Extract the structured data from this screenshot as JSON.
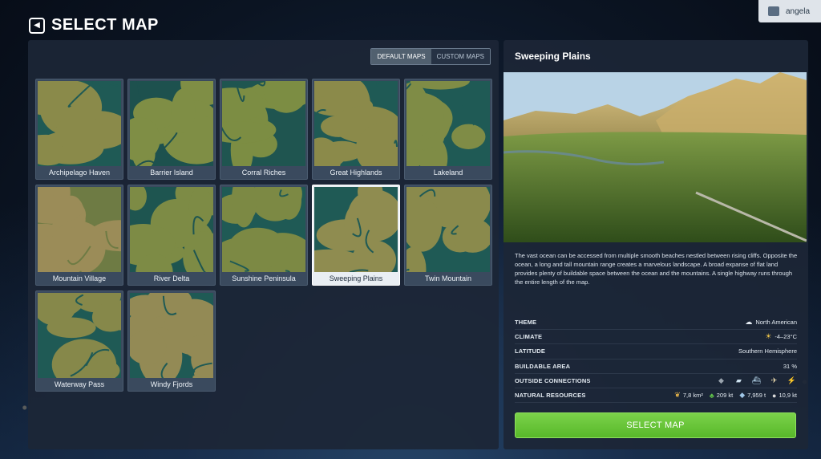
{
  "header": {
    "title": "SELECT MAP",
    "back_icon": "◀"
  },
  "user": {
    "name": "angela"
  },
  "tabs": [
    {
      "label": "DEFAULT MAPS",
      "active": true
    },
    {
      "label": "CUSTOM MAPS",
      "active": false
    }
  ],
  "maps": [
    {
      "name": "Archipelago Haven",
      "land": "#8a8a4a",
      "water": "#1f5a55"
    },
    {
      "name": "Barrier Island",
      "land": "#7f8e45",
      "water": "#1d514e"
    },
    {
      "name": "Corral Riches",
      "land": "#7c8d43",
      "water": "#1f5550"
    },
    {
      "name": "Great Highlands",
      "land": "#8b8a4a",
      "water": "#1f5a55"
    },
    {
      "name": "Lakeland",
      "land": "#7f8c46",
      "water": "#1f5a55"
    },
    {
      "name": "Mountain Village",
      "land": "#9b8c58",
      "water": "#6e7b44"
    },
    {
      "name": "River Delta",
      "land": "#7d8b45",
      "water": "#1e5550"
    },
    {
      "name": "Sunshine Peninsula",
      "land": "#7c8944",
      "water": "#1f5a55"
    },
    {
      "name": "Sweeping Plains",
      "land": "#8f8c50",
      "water": "#1f5a55",
      "selected": true
    },
    {
      "name": "Twin Mountain",
      "land": "#8a8a4c",
      "water": "#1f5a55"
    },
    {
      "name": "Waterway Pass",
      "land": "#86884a",
      "water": "#1f5a55"
    },
    {
      "name": "Windy Fjords",
      "land": "#938a55",
      "water": "#1f5a55"
    }
  ],
  "detail": {
    "name": "Sweeping Plains",
    "description": "The vast ocean can be accessed from multiple smooth beaches nestled between rising cliffs. Opposite the ocean, a long and tall mountain range creates a marvelous landscape. A broad expanse of flat land provides plenty of buildable space between the ocean and the mountains. A single highway runs through the entire length of the map.",
    "theme_label": "THEME",
    "theme_value": "North American",
    "climate_label": "CLIMATE",
    "climate_value": "-4–23°C",
    "latitude_label": "LATITUDE",
    "latitude_value": "Southern Hemisphere",
    "buildable_label": "BUILDABLE AREA",
    "buildable_value": "31 %",
    "connections_label": "OUTSIDE CONNECTIONS",
    "connections_icons": [
      "road-icon",
      "train-icon",
      "ship-icon",
      "airplane-icon",
      "electricity-icon"
    ],
    "resources_label": "NATURAL RESOURCES",
    "resources": [
      {
        "icon": "fertile-land-icon",
        "value": "7,8 km²"
      },
      {
        "icon": "forest-icon",
        "value": "209 kt"
      },
      {
        "icon": "ore-icon",
        "value": "7,959 t"
      },
      {
        "icon": "oil-icon",
        "value": "10,9 kt"
      }
    ],
    "select_label": "SELECT MAP"
  },
  "colors": {
    "accent_green": "#6cc73a",
    "panel_bg": "#1c2636"
  }
}
